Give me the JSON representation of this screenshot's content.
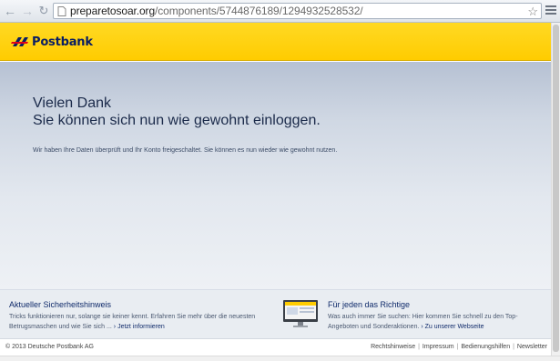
{
  "browser": {
    "url_host": "preparetosoar.org",
    "url_path": "/components/5744876189/1294932528532/",
    "icons": [
      "back-icon",
      "forward-icon",
      "reload-icon",
      "page-icon",
      "star-icon",
      "menu-icon"
    ]
  },
  "header": {
    "logo_text": "Postbank",
    "brand_color": "#ffcc00",
    "logo_color": "#0a1e63"
  },
  "main": {
    "title": "Vielen Dank",
    "subtitle": "Sie können sich nun wie gewohnt einloggen.",
    "message": "Wir haben Ihre Daten überprüft und Ihr Konto freigeschaltet. Sie können es nun wieder wie gewohnt nutzen."
  },
  "teasers": {
    "left": {
      "title": "Aktueller Sicherheitshinweis",
      "text": "Tricks funktionieren nur, solange sie keiner kennt. Erfahren Sie mehr über die neuesten Betrugsmaschen und wie Sie sich ...",
      "link": "Jetzt informieren"
    },
    "right": {
      "title": "Für jeden das Richtige",
      "text": "Was auch immer Sie suchen: Hier kommen Sie schnell zu den Top-Angeboten und Sonderaktionen.",
      "link": "Zu unserer Webseite"
    }
  },
  "footer": {
    "copyright": "© 2013 Deutsche Postbank AG",
    "links": [
      "Rechtshinweise",
      "Impressum",
      "Bedienungshilfen",
      "Newsletter"
    ]
  }
}
